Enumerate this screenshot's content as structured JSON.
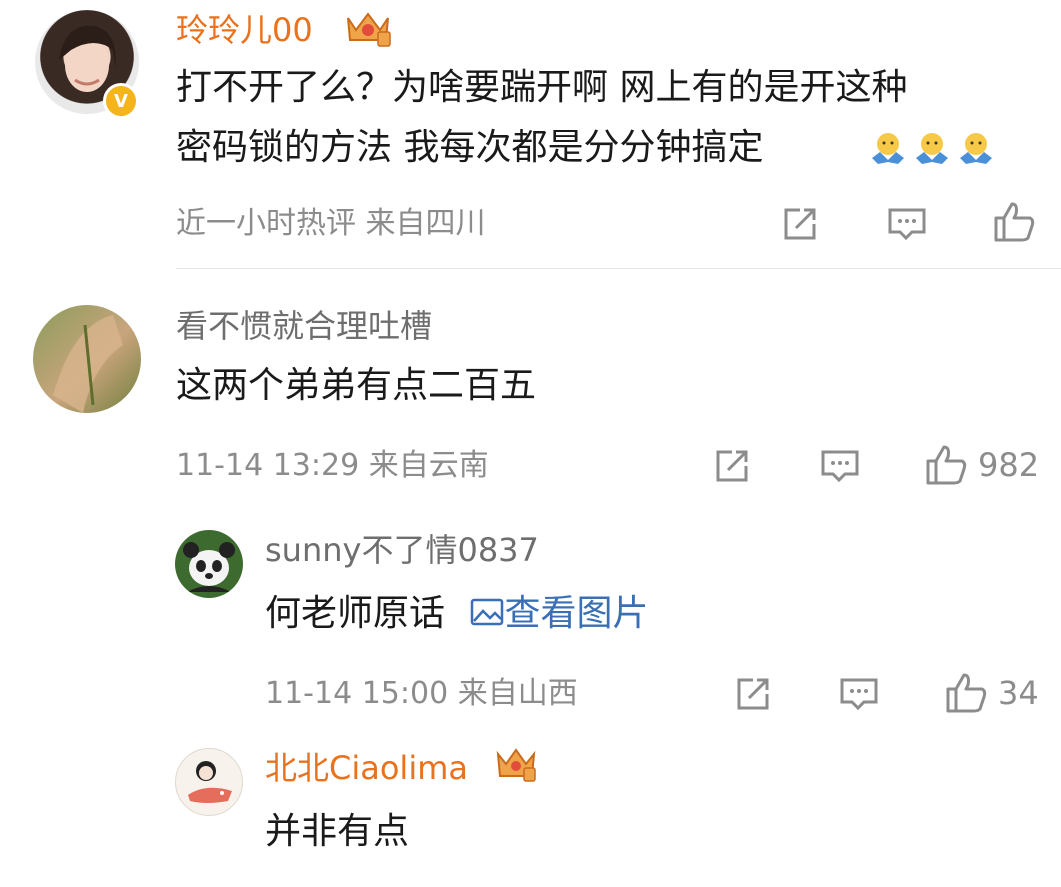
{
  "colors": {
    "username_vip": "#e8721d",
    "username_normal": "#6e6e6e",
    "meta": "#8c8c8c",
    "link": "#3a6fb5",
    "verified_badge": "#f3b41c"
  },
  "comments": [
    {
      "username": "玲玲儿00",
      "verified_badge": "V",
      "text_line1": "打不开了么？为啥要踹开啊 网上有的是开这种",
      "text_line2": "密码锁的方法 我每次都是分分钟搞定",
      "meta": "近一小时热评  来自四川",
      "likes": ""
    },
    {
      "username": "看不惯就合理吐槽",
      "text": "这两个弟弟有点二百五",
      "meta": "11-14 13:29  来自云南",
      "likes": "982"
    }
  ],
  "replies": [
    {
      "username": "sunny不了情0837",
      "text": "何老师原话",
      "link_text": "查看图片",
      "meta": "11-14 15:00  来自山西",
      "likes": "34"
    },
    {
      "username": "北北Ciaolima",
      "text": "并非有点"
    }
  ],
  "icons": [
    "share-icon",
    "comment-icon",
    "like-icon",
    "crown-badge-icon",
    "image-icon",
    "shrug-emoji-icon"
  ]
}
